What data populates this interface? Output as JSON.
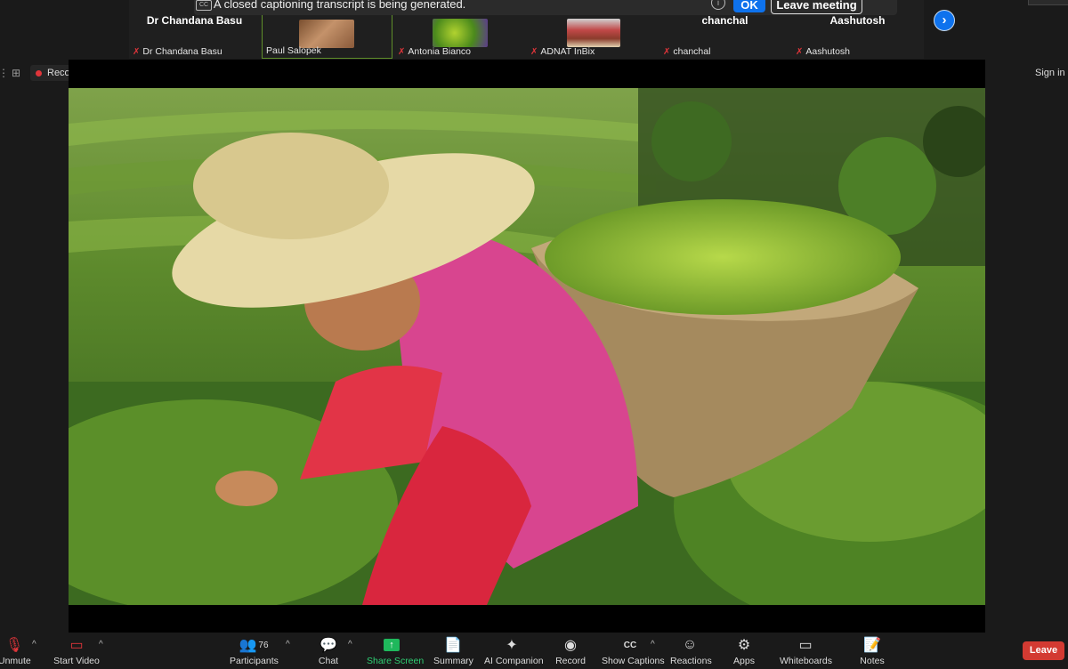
{
  "caption_banner": {
    "cc_label": "CC",
    "text": "A closed captioning transcript is being generated.",
    "ok_label": "OK",
    "leave_meeting_label": "Leave meeting"
  },
  "participants": [
    {
      "display_name": "Dr Chandana Basu",
      "label": "Dr Chandana Basu",
      "muted": true
    },
    {
      "display_name": "",
      "label": "Paul Salopek",
      "muted": false,
      "active": true
    },
    {
      "display_name": "",
      "label": "Antonia Bianco",
      "muted": true
    },
    {
      "display_name": "",
      "label": "ADNAT InBix",
      "muted": true
    },
    {
      "display_name": "chanchal",
      "label": "chanchal",
      "muted": true
    },
    {
      "display_name": "Aashutosh",
      "label": "Aashutosh",
      "muted": true
    }
  ],
  "status": {
    "recording_label": "Recording",
    "sign_in_label": "Sign in"
  },
  "toolbar": {
    "unmute": "Unmute",
    "start_video": "Start Video",
    "participants": "Participants",
    "participants_count": "76",
    "chat": "Chat",
    "share_screen": "Share Screen",
    "summary": "Summary",
    "ai_companion": "AI Companion",
    "record": "Record",
    "show_captions": "Show Captions",
    "reactions": "Reactions",
    "apps": "Apps",
    "whiteboards": "Whiteboards",
    "notes": "Notes",
    "leave": "Leave"
  },
  "colors": {
    "accent_blue": "#0e72ed",
    "share_green": "#1fb85c",
    "leave_red": "#d33a32",
    "recording_red": "#e0353a"
  }
}
